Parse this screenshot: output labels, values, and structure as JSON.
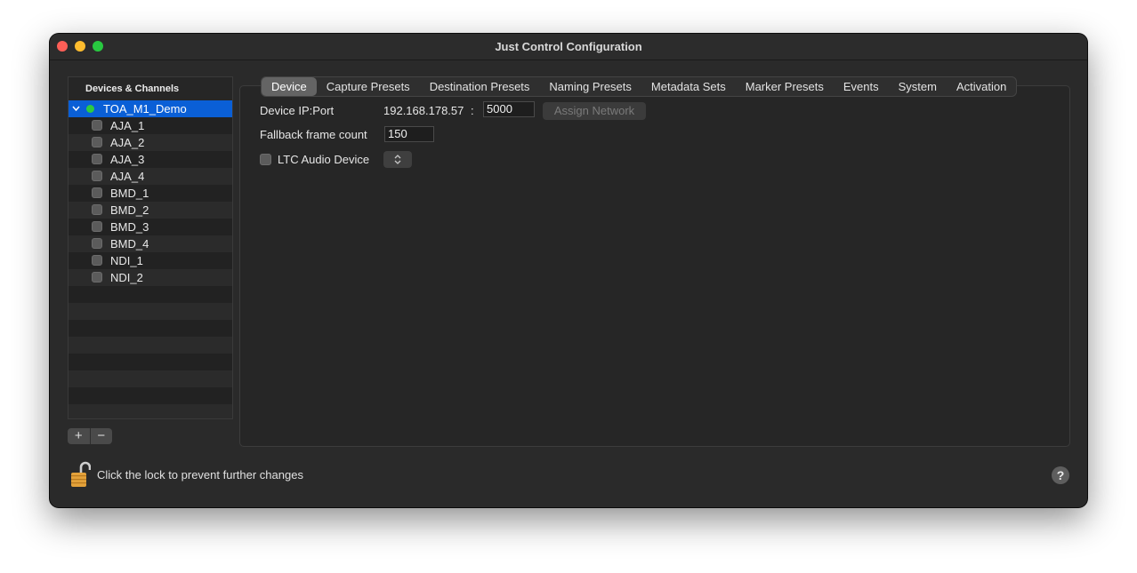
{
  "window": {
    "title": "Just Control Configuration"
  },
  "sidebar": {
    "header": "Devices & Channels",
    "device": {
      "name": "TOA_M1_Demo",
      "status_color": "#2ecc3f"
    },
    "channels": [
      "AJA_1",
      "AJA_2",
      "AJA_3",
      "AJA_4",
      "BMD_1",
      "BMD_2",
      "BMD_3",
      "BMD_4",
      "NDI_1",
      "NDI_2"
    ],
    "add_label": "+",
    "remove_label": "−"
  },
  "tabs": [
    "Device",
    "Capture Presets",
    "Destination Presets",
    "Naming Presets",
    "Metadata Sets",
    "Marker Presets",
    "Events",
    "System",
    "Activation"
  ],
  "active_tab": "Device",
  "device_tab": {
    "ip_label": "Device IP:Port",
    "ip_value": "192.168.178.57",
    "colon": ":",
    "port_value": "5000",
    "assign_button": "Assign Network",
    "fallback_label": "Fallback frame count",
    "fallback_value": "150",
    "ltc_label": "LTC Audio Device",
    "ltc_popup_icon": "⌃⌄"
  },
  "footer": {
    "lock_text": "Click the lock to prevent further changes",
    "help_label": "?"
  },
  "colors": {
    "selection": "#0a5fd6",
    "background": "#2a2a2a"
  }
}
